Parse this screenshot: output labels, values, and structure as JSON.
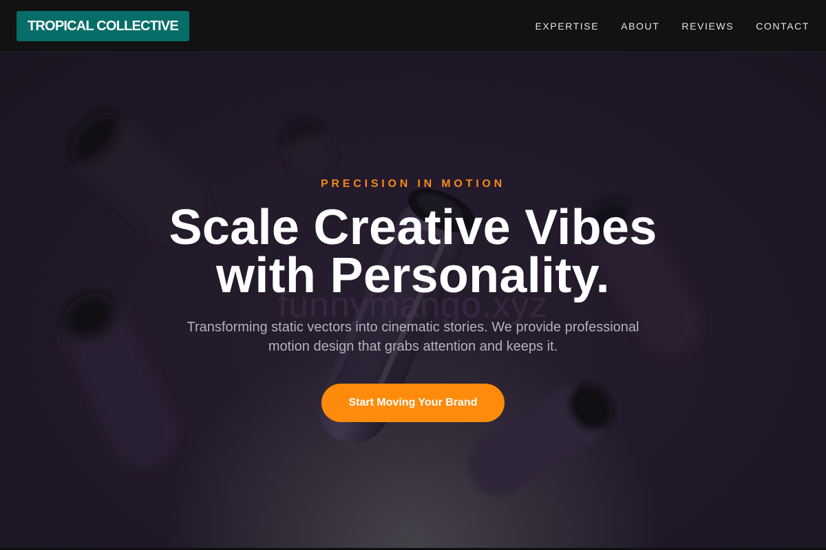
{
  "nav": {
    "logo": "TROPICAL COLLECTIVE",
    "links": [
      "EXPERTISE",
      "ABOUT",
      "REVIEWS",
      "CONTACT"
    ]
  },
  "hero": {
    "kicker": "PRECISION IN MOTION",
    "headline_line1": "Scale Creative Vibes",
    "headline_line2": "with Personality.",
    "subtitle_line1": "Transforming static vectors into cinematic stories. We provide professional",
    "subtitle_line2": "motion design that grabs attention and keeps it.",
    "cta_label": "Start Moving Your Brand",
    "watermark": "funnymango.xyz"
  },
  "colors": {
    "logo_bg": "#066d68",
    "accent": "#ff8b0c",
    "kicker": "#f68a1c",
    "nav_bg": "#121212",
    "hero_bg": "#261c30"
  }
}
